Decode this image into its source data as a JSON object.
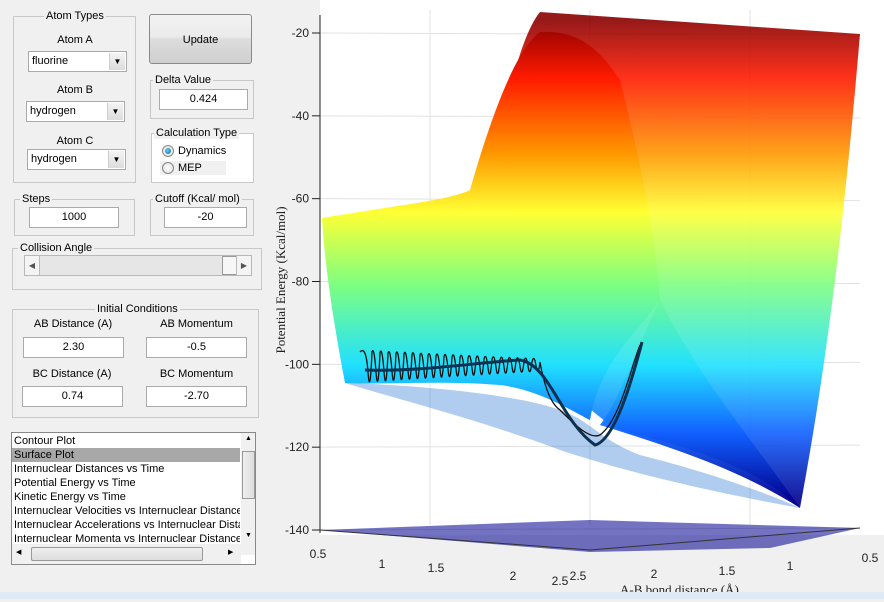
{
  "atom_types": {
    "title": "Atom Types",
    "atom_a": {
      "label": "Atom A",
      "value": "fluorine"
    },
    "atom_b": {
      "label": "Atom B",
      "value": "hydrogen"
    },
    "atom_c": {
      "label": "Atom C",
      "value": "hydrogen"
    }
  },
  "update_label": "Update",
  "delta": {
    "title": "Delta Value",
    "value": "0.424"
  },
  "calc_type": {
    "title": "Calculation Type",
    "options": [
      "Dynamics",
      "MEP"
    ],
    "selected": "Dynamics"
  },
  "steps": {
    "title": "Steps",
    "value": "1000"
  },
  "cutoff": {
    "title": "Cutoff (Kcal/ mol)",
    "value": "-20"
  },
  "collision_angle": {
    "title": "Collision Angle",
    "slider_position": 0.97
  },
  "initial": {
    "title": "Initial Conditions",
    "ab_distance": {
      "label": "AB Distance (A)",
      "value": "2.30"
    },
    "ab_momentum": {
      "label": "AB Momentum",
      "value": "-0.5"
    },
    "bc_distance": {
      "label": "BC Distance (A)",
      "value": "0.74"
    },
    "bc_momentum": {
      "label": "BC Momentum",
      "value": "-2.70"
    }
  },
  "plot_list": {
    "items": [
      "Contour Plot",
      "Surface Plot",
      "Internuclear Distances vs Time",
      "Potential Energy vs Time",
      "Kinetic Energy vs Time",
      "Internuclear Velocities vs Internuclear Distance",
      "Internuclear Accelerations vs Internuclear Distance",
      "Internuclear Momenta vs Internuclear Distance"
    ],
    "selected": "Surface Plot"
  },
  "chart_data": {
    "type": "surface",
    "ylabel": "Potential Energy (Kcal/mol)",
    "xlabel": "A-B bond distance (Å)",
    "z_ticks": [
      "-20",
      "-40",
      "-60",
      "-80",
      "-100",
      "-120",
      "-140"
    ],
    "zlim": [
      -140,
      -20
    ],
    "x_ticks_left": [
      "0.5",
      "1",
      "1.5",
      "2",
      "2.5"
    ],
    "x_ticks_right": [
      "2.5",
      "2",
      "1.5",
      "1",
      "0.5"
    ],
    "colormap": "jet",
    "grid": true
  }
}
